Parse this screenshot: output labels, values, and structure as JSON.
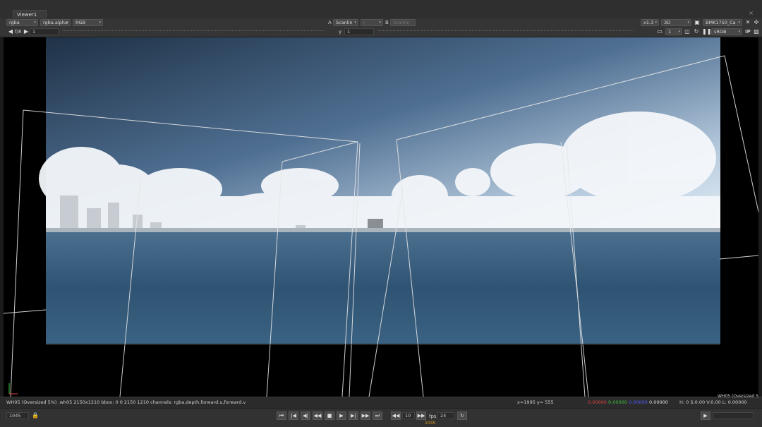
{
  "window": {
    "tab_label": "Viewer1",
    "close_glyph": "×"
  },
  "toolbar1": {
    "channels": "rgba",
    "alpha_channel": "rgba.alpha",
    "display_channels": "RGB",
    "input_a_label": "A",
    "input_a": "Scanlin",
    "compare_mode": "-",
    "input_b_label": "B",
    "input_b": "Scanlin",
    "zoom": "x1.3",
    "view_mode": "3D",
    "camera": "BMK1750_Ca"
  },
  "toolbar2": {
    "fstop": "f/8",
    "gain_value": "1",
    "gamma_label": "y",
    "gamma_value": "1",
    "proxy_value": "1",
    "lut": "sRGB",
    "ip_label": "IP"
  },
  "status": {
    "info": "WH05 (Oversized 5%) .wh05 2150x1210 bbox: 0 0 2150 1210 channels: rgba,depth,forward.u,forward.v",
    "coords": "x=1995 y= 555",
    "red": "0.00000",
    "green": "0.00000",
    "blue": "0.00000",
    "alpha": "0.00000",
    "hsvl": "H:  0 S:0.00 V:0.00  L: 0.00000",
    "format_overlay": "WH05 (Oversized 5"
  },
  "playback": {
    "current_frame": "1045",
    "skip": "10",
    "fps_label": "fps",
    "fps": "24",
    "timeline_marker": "1045",
    "buttons": [
      "⏮",
      "|◀",
      "◀|",
      "◀◀",
      "■",
      "▶",
      "▶|",
      "▶▶",
      "⏭"
    ]
  },
  "colors": {
    "red": "#e04040",
    "green": "#40c040",
    "blue": "#5060ff",
    "alpha": "#e0e0e0"
  },
  "icons": [
    "lock-icon",
    "loop-icon",
    "camera-icon",
    "pause-icon",
    "grid-icon"
  ]
}
